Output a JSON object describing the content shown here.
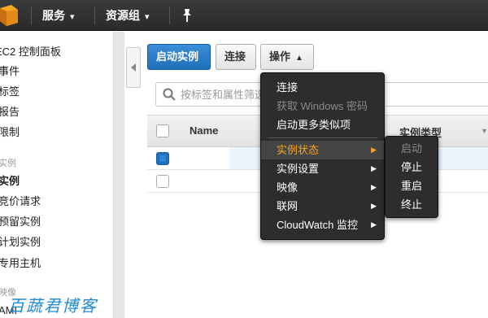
{
  "topbar": {
    "services_label": "服务",
    "resource_groups_label": "资源组"
  },
  "sidebar": {
    "items": [
      {
        "label": "EC2 控制面板"
      },
      {
        "label": "事件"
      },
      {
        "label": "标签"
      },
      {
        "label": "报告"
      },
      {
        "label": "限制"
      }
    ],
    "instances_section": "实例",
    "instance_items": [
      {
        "label": "实例"
      },
      {
        "label": "竞价请求"
      },
      {
        "label": "预留实例"
      },
      {
        "label": "计划实例"
      },
      {
        "label": "专用主机"
      }
    ],
    "images_section": "映像",
    "image_items": [
      {
        "label": "AMI"
      }
    ]
  },
  "toolbar": {
    "launch_label": "启动实例",
    "connect_label": "连接",
    "actions_label": "操作"
  },
  "search": {
    "placeholder": "按标签和属性筛选"
  },
  "table": {
    "col_name": "Name",
    "col_type": "实例类型"
  },
  "actions_menu": {
    "items": [
      {
        "label": "连接",
        "disabled": false
      },
      {
        "label": "获取 Windows 密码",
        "disabled": true
      },
      {
        "label": "启动更多类似项",
        "disabled": false
      },
      {
        "label": "实例状态",
        "submenu": true,
        "highlighted": true
      },
      {
        "label": "实例设置",
        "submenu": true
      },
      {
        "label": "映像",
        "submenu": true
      },
      {
        "label": "联网",
        "submenu": true
      },
      {
        "label": "CloudWatch 监控",
        "submenu": true
      }
    ]
  },
  "state_submenu": {
    "items": [
      {
        "label": "启动",
        "disabled": true
      },
      {
        "label": "停止",
        "disabled": false
      },
      {
        "label": "重启",
        "disabled": false
      },
      {
        "label": "终止",
        "disabled": false
      }
    ]
  },
  "watermark": "百蔬君博客",
  "colors": {
    "topbar": "#2f2f2f",
    "primary": "#1f6fb9",
    "menu_bg": "#2d2d2d",
    "menu_highlight": "#f5a623",
    "watermark": "#1d8ad2"
  }
}
